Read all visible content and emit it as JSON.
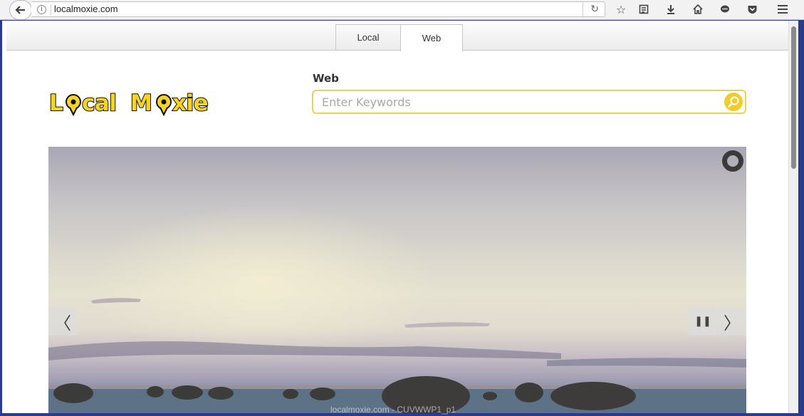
{
  "browser": {
    "url": "localmoxie.com"
  },
  "tabs": [
    {
      "label": "Local"
    },
    {
      "label": "Web"
    }
  ],
  "logo": {
    "text": "Local Moxie",
    "colors": {
      "fill": "#f5d327",
      "outline": "#111111"
    }
  },
  "search": {
    "label": "Web",
    "placeholder": "Enter Keywords",
    "value": "",
    "accent": "#e7d35a"
  },
  "slideshow": {
    "prev_symbol": "〈",
    "next_symbol": "〉",
    "pause_symbol": "❚❚"
  },
  "footer": {
    "watermark": "localmoxie.com - CUVWWP1_p1"
  }
}
